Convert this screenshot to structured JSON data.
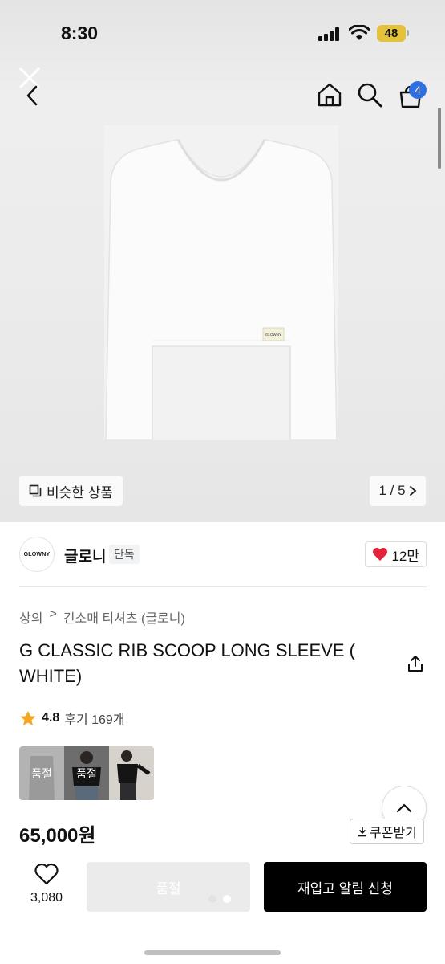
{
  "status_bar": {
    "time": "8:30",
    "battery": "48"
  },
  "header": {
    "cart_count": "4"
  },
  "gallery": {
    "similar_label": "비슷한 상품",
    "pager": "1 / 5",
    "label_text": "GLOWNY"
  },
  "brand": {
    "logo_text": "GLOWNY",
    "name": "글로니",
    "badge": "단독",
    "likes": "12만"
  },
  "breadcrumb": {
    "category": "상의",
    "subcategory": "긴소매 티셔츠 (글로니)"
  },
  "product": {
    "title": "G CLASSIC RIB SCOOP LONG SLEEVE ( WHITE)",
    "rating": "4.8",
    "reviews": "후기 169개",
    "price": "65,000원",
    "coupon_label": "쿠폰받기"
  },
  "thumbnails": [
    {
      "label": "품절"
    },
    {
      "label": "품절"
    },
    {
      "label": ""
    }
  ],
  "bottom_bar": {
    "wish_count": "3,080",
    "soldout_label": "품절",
    "restock_label": "재입고 알림 신청"
  },
  "icons": [
    "close-icon",
    "back-arrow-icon",
    "home-icon",
    "search-icon",
    "cart-icon",
    "similar-items-icon",
    "chevron-right-icon",
    "heart-filled-icon",
    "share-icon",
    "star-icon",
    "chevron-up-icon",
    "download-icon",
    "heart-outline-icon"
  ],
  "colors": {
    "accent_badge": "#2f6fe4",
    "heart": "#e5233a",
    "star": "#f5a623",
    "primary_button": "#000000"
  }
}
